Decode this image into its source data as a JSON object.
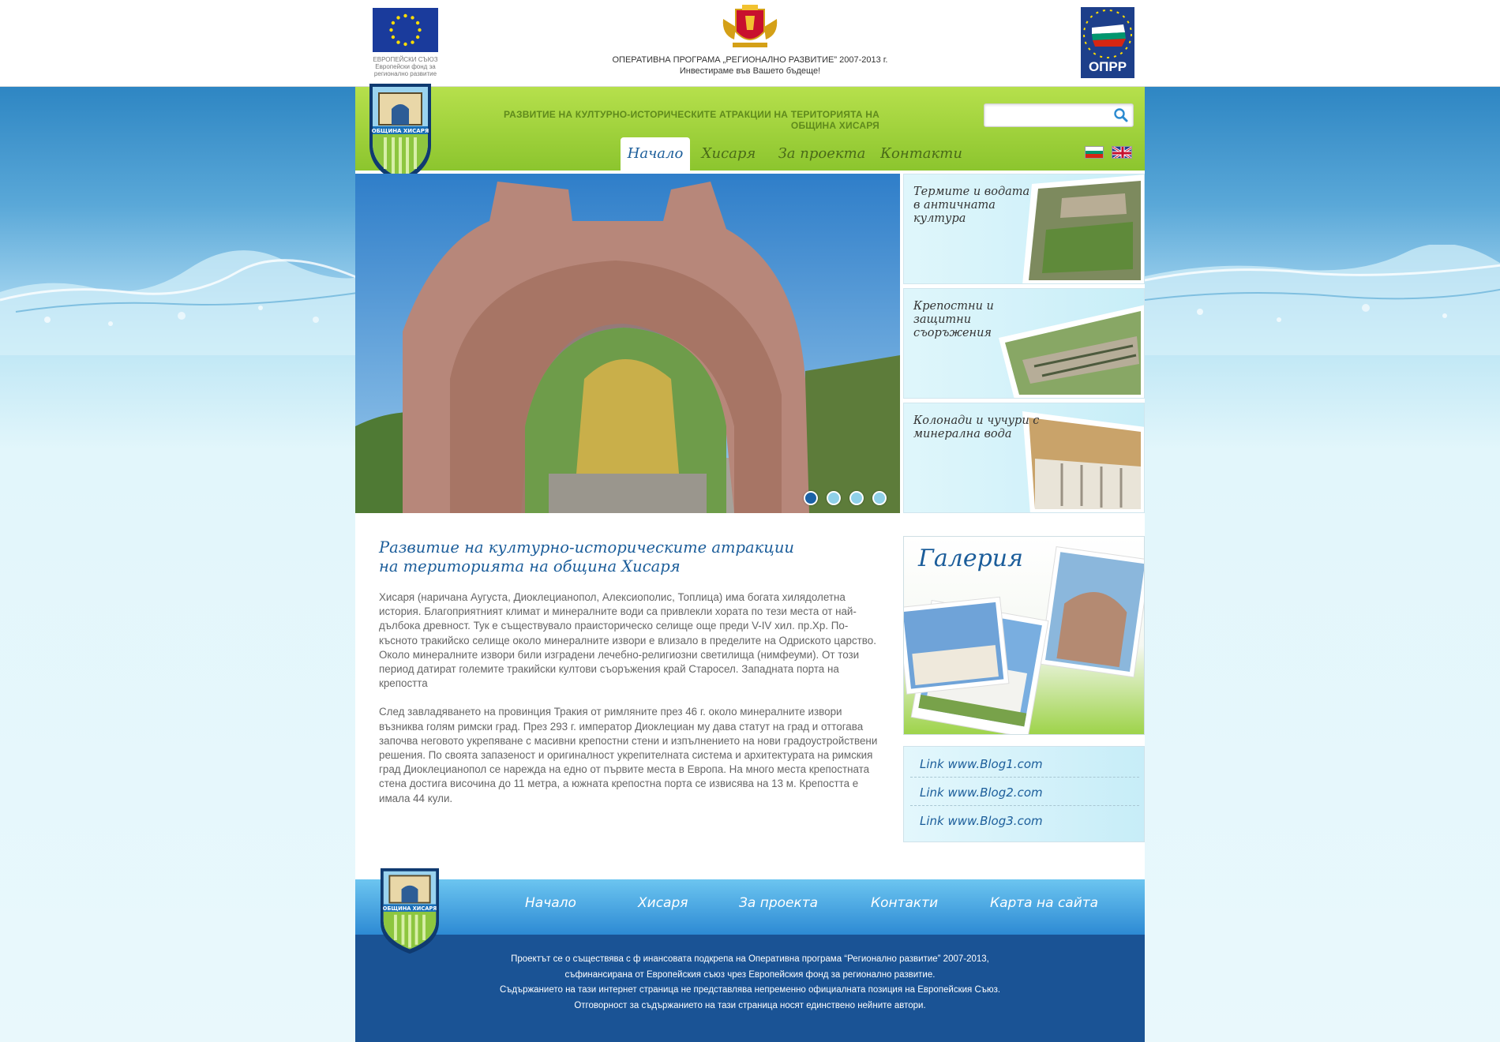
{
  "topbar": {
    "eu_caption": [
      "ЕВРОПЕЙСКИ СЪЮЗ",
      "Европейски фонд за",
      "регионално развитие"
    ],
    "program_line1": "ОПЕРАТИВНА ПРОГРАМА „РЕГИОНАЛНО РАЗВИТИЕ” 2007-2013 г.",
    "program_line2": "Инвестираме във Вашето бъдеще!",
    "opr_logo_text": "ОПРР"
  },
  "crest": {
    "text": "ОБЩИНА ХИСАРЯ"
  },
  "header": {
    "title": "РАЗВИТИЕ НА КУЛТУРНО-ИСТОРИЧЕСКИТЕ АТРАКЦИИ НА ТЕРИТОРИЯТА НА ОБЩИНА ХИСАРЯ",
    "search_placeholder": "",
    "search_value": ""
  },
  "nav": {
    "items": [
      {
        "label": "Начало",
        "active": true
      },
      {
        "label": "Хисаря",
        "active": false
      },
      {
        "label": "За проекта",
        "active": false
      },
      {
        "label": "Контакти",
        "active": false
      }
    ]
  },
  "languages": [
    "bg-flag-icon",
    "gb-flag-icon"
  ],
  "slider": {
    "active_index": 0,
    "count": 4
  },
  "side_tiles": [
    {
      "text": "Термите и водата в античната култура"
    },
    {
      "text": "Крепостни и защитни съоръжения"
    },
    {
      "text": "Колонади и чучури с минерална вода"
    }
  ],
  "content": {
    "title_line1": "Развитие на културно-историческите атракции",
    "title_line2": "на територията на община Хисаря",
    "paragraph1": "Хисаря (наричана Аугуста, Диоклецианопол, Алексиополис, Топлица) има богата хилядолетна история. Благоприятният климат и минералните води са привлекли хората по тези места от най-дълбока древност. Тук е съществувало праисторическо селище още преди V-IV хил. пр.Хр. По-късното тракийско селище около минералните извори е влизало в пределите на Одриското царство. Около минералните извори били изградени лечебно-религиозни светилища (нимфеуми). От този период датират големите тракийски култови съоръжения край Старосел. Западната порта на крепостта",
    "paragraph2": "След завладяването на провинция Тракия от римляните през 46 г. около минералните извори възниква голям римски град. През 293 г. император Диоклециан му дава статут на град и оттогава започва неговото укрепяване с масивни крепостни стени и изпълнението на нови градоустройствени решения. По своята запазеност и оригиналност укрепителната система и архитектурата на римския град Диоклецианопол се нарежда на едно от първите места в Европа. На много места крепостната стена достига височина до 11 метра, а южната крепостна порта се извисява на 13 м. Крепостта е имала 44 кули."
  },
  "gallery": {
    "title": "Галерия"
  },
  "links": [
    "Link www.Blog1.com",
    "Link www.Blog2.com",
    "Link www.Blog3.com"
  ],
  "footer": {
    "nav": [
      "Начало",
      "Хисаря",
      "За проекта",
      "Контакти",
      "Карта на сайта"
    ],
    "lines": [
      "Проектът се о съществява с ф инансовата подкрепа на Оперативна програма “Регионално развитие” 2007-2013,",
      "съфинансирана от Европейския съюз чрез Европейския фонд за регионално развитие.",
      "Съдържанието на тази интернет страница не представлява непременно официалната позиция на Европейския Съюз.",
      "Отговорност за съдържанието на тази страница носят единствено нейните автори."
    ]
  },
  "colors": {
    "accent": "#1b5d9a",
    "green": "#9ccf3a",
    "footer_blue": "#1a5395"
  }
}
